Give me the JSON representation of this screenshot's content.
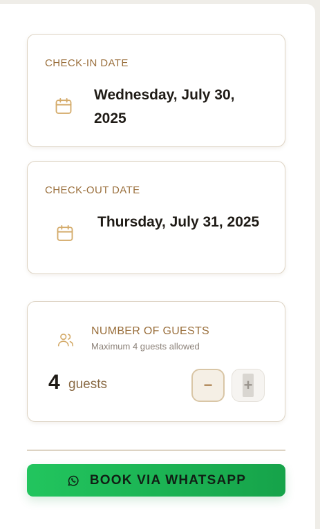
{
  "checkin": {
    "label": "CHECK-IN DATE",
    "value": "Wednesday, July 30, 2025",
    "icon": "calendar-icon"
  },
  "checkout": {
    "label": "CHECK-OUT DATE",
    "value": "Thursday, July 31, 2025",
    "icon": "calendar-icon"
  },
  "guests": {
    "title": "NUMBER OF GUESTS",
    "subtitle": "Maximum 4 guests allowed",
    "count": "4",
    "unit": "guests",
    "decrement_label": "−",
    "increment_label": "+",
    "icon": "users-icon"
  },
  "book": {
    "label": "BOOK VIA WHATSAPP",
    "icon": "whatsapp-icon"
  },
  "colors": {
    "accent": "#9a6f3c",
    "border": "#ddd3c3",
    "whatsapp_green": "#22c55e"
  }
}
